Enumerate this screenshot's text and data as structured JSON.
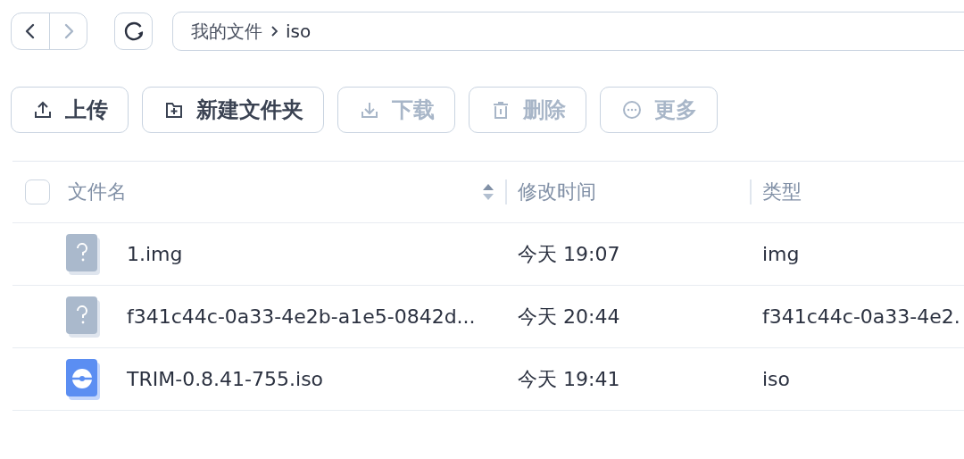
{
  "nav": [
    {
      "kind": "back",
      "disabled": false
    },
    {
      "kind": "forward",
      "disabled": true
    }
  ],
  "breadcrumb": [
    "我的文件",
    "iso"
  ],
  "toolbar": [
    {
      "kind": "upload",
      "label": "上传",
      "disabled": false
    },
    {
      "kind": "new-folder",
      "label": "新建文件夹",
      "disabled": false
    },
    {
      "kind": "download",
      "label": "下载",
      "disabled": true
    },
    {
      "kind": "delete",
      "label": "删除",
      "disabled": true
    },
    {
      "kind": "more",
      "label": "更多",
      "disabled": true
    }
  ],
  "table": {
    "select_all": {
      "checked": false
    },
    "columns": [
      "文件名",
      "修改时间",
      "类型"
    ],
    "rows": [
      {
        "kind": "unknown",
        "name": "1.img",
        "modified": "今天 19:07",
        "type": "img"
      },
      {
        "kind": "unknown",
        "name": "f341c44c-0a33-4e2b-a1e5-0842d...",
        "modified": "今天 20:44",
        "type": "f341c44c-0a33-4e2."
      },
      {
        "kind": "disc",
        "name": "TRIM-0.8.41-755.iso",
        "modified": "今天 19:41",
        "type": "iso"
      }
    ]
  }
}
